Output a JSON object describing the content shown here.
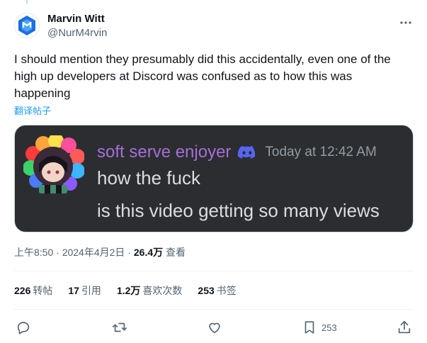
{
  "author": {
    "display_name": "Marvin Witt",
    "handle": "@NurM4rvin",
    "avatar_icon": "logo-avatar-icon"
  },
  "tweet": {
    "text": "I should mention they presumably did this accidentally, even one of the\nhigh up developers at Discord was confused as to how this was\nhappening",
    "translate_label": "翻译帖子"
  },
  "media": {
    "username": "soft serve enjoyer",
    "badge_icon": "discord-icon",
    "timestamp": "Today at 12:42 AM",
    "line1": "how the fuck",
    "line2": "is this video getting so many views",
    "username_color": "#a66fd6"
  },
  "meta": {
    "time": "上午8:50",
    "date": "2024年4月2日",
    "views_count": "26.4万",
    "views_label": "查看",
    "sep": "·"
  },
  "stats": [
    {
      "count": "226",
      "label": "转帖"
    },
    {
      "count": "17",
      "label": "引用"
    },
    {
      "count": "1.2万",
      "label": "喜欢次数"
    },
    {
      "count": "253",
      "label": "书签"
    }
  ],
  "actions": {
    "bookmark_count": "253"
  },
  "colors": {
    "accent": "#1d9bf0",
    "muted": "#536471",
    "discord_bg": "#2b2d31"
  }
}
